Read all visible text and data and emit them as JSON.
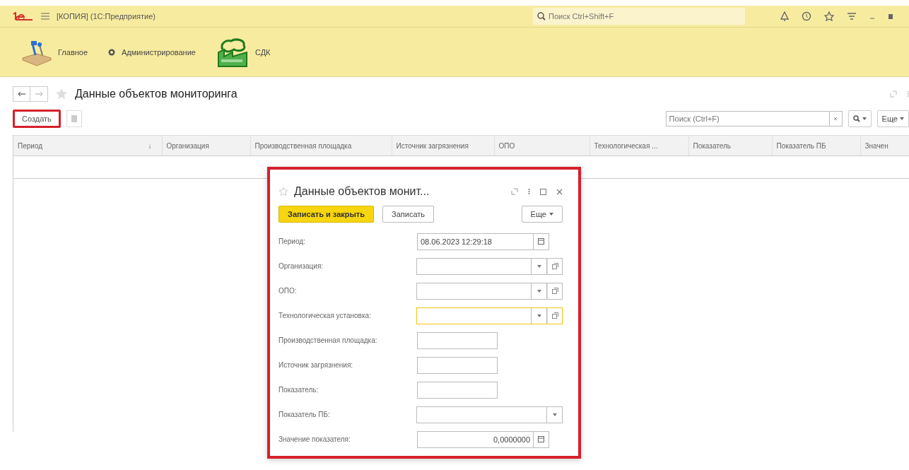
{
  "top_bar": {
    "title": "[КОПИЯ]  (1С:Предприятие)",
    "search": {
      "placeholder": "Поиск Ctrl+Shift+F"
    }
  },
  "sections": [
    {
      "label": "Главное"
    },
    {
      "label": "Администрирование"
    },
    {
      "label": "СДК"
    }
  ],
  "list_form": {
    "title": "Данные объектов мониторинга",
    "toolbar": {
      "create_button": {
        "label": "Создать",
        "highlighted": true
      },
      "search": {
        "placeholder": "Поиск (Ctrl+F)"
      },
      "more_button": "Еще"
    },
    "table": {
      "columns": [
        {
          "label": "Период",
          "sort": "↓"
        },
        {
          "label": "Организация"
        },
        {
          "label": "Производственная площадка"
        },
        {
          "label": "Источник загрязнения"
        },
        {
          "label": "ОПО"
        },
        {
          "label": "Технологическая ..."
        },
        {
          "label": "Показатель"
        },
        {
          "label": "Показатель ПБ"
        },
        {
          "label": "Значен"
        }
      ]
    }
  },
  "dialog": {
    "title": "Данные объектов монит...",
    "highlighted": true,
    "buttons": [
      {
        "label": "Записать и закрыть",
        "kind": "primary"
      },
      {
        "label": "Записать",
        "kind": "normal"
      }
    ],
    "more_button": "Еще",
    "fields": [
      {
        "label": "Период:",
        "kind": "date",
        "value": "08.06.2023 12:29:18",
        "focused": false
      },
      {
        "label": "Организация:",
        "kind": "select",
        "focused": false
      },
      {
        "label": "ОПО:",
        "kind": "select",
        "focused": false
      },
      {
        "label": "Технологическая установка:",
        "kind": "select",
        "focused": true
      },
      {
        "label": "Производственная площадка:",
        "kind": "input",
        "focused": false
      },
      {
        "label": "Источник загрязнения:",
        "kind": "input",
        "focused": false
      },
      {
        "label": "Показатель:",
        "kind": "input",
        "focused": false
      },
      {
        "label": "Показатель ПБ:",
        "kind": "dropdown",
        "focused": false
      },
      {
        "label": "Значение показателя:",
        "kind": "number",
        "value": "0,0000000",
        "focused": false
      }
    ]
  }
}
